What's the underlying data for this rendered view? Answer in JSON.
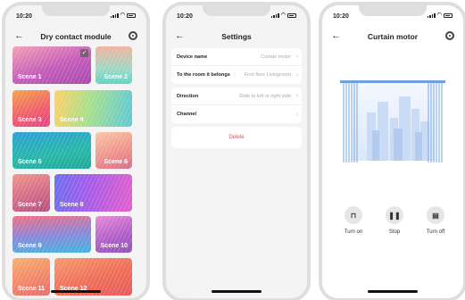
{
  "phone1": {
    "time": "10:20",
    "title": "Dry contact module",
    "scenes": [
      "Scene 1",
      "Scene 2",
      "Scene 3",
      "Scene 4",
      "Scene 5",
      "Scene 6",
      "Scene 7",
      "Scene 8",
      "Scene 9",
      "Scene 10",
      "Scene 11",
      "Scene 12"
    ]
  },
  "phone2": {
    "time": "10:20",
    "title": "Settings",
    "rows": [
      {
        "label": "Device name",
        "value": "Curtain motor"
      },
      {
        "label": "To the room it belongs",
        "value": "First floor  Livingroom"
      },
      {
        "label": "Direction",
        "value": "Slide to left or right side"
      },
      {
        "label": "Channel",
        "value": ""
      }
    ],
    "delete_label": "Delete"
  },
  "phone3": {
    "time": "10:20",
    "title": "Curtain motor",
    "controls": [
      {
        "label": "Turn on",
        "icon": "curtain-open-icon"
      },
      {
        "label": "Stop",
        "icon": "pause-icon"
      },
      {
        "label": "Turn off",
        "icon": "curtain-close-icon"
      }
    ]
  },
  "colors": {
    "delete": "#e05050",
    "background": "#f4f4f4",
    "curtain": "#8ab4e6"
  }
}
